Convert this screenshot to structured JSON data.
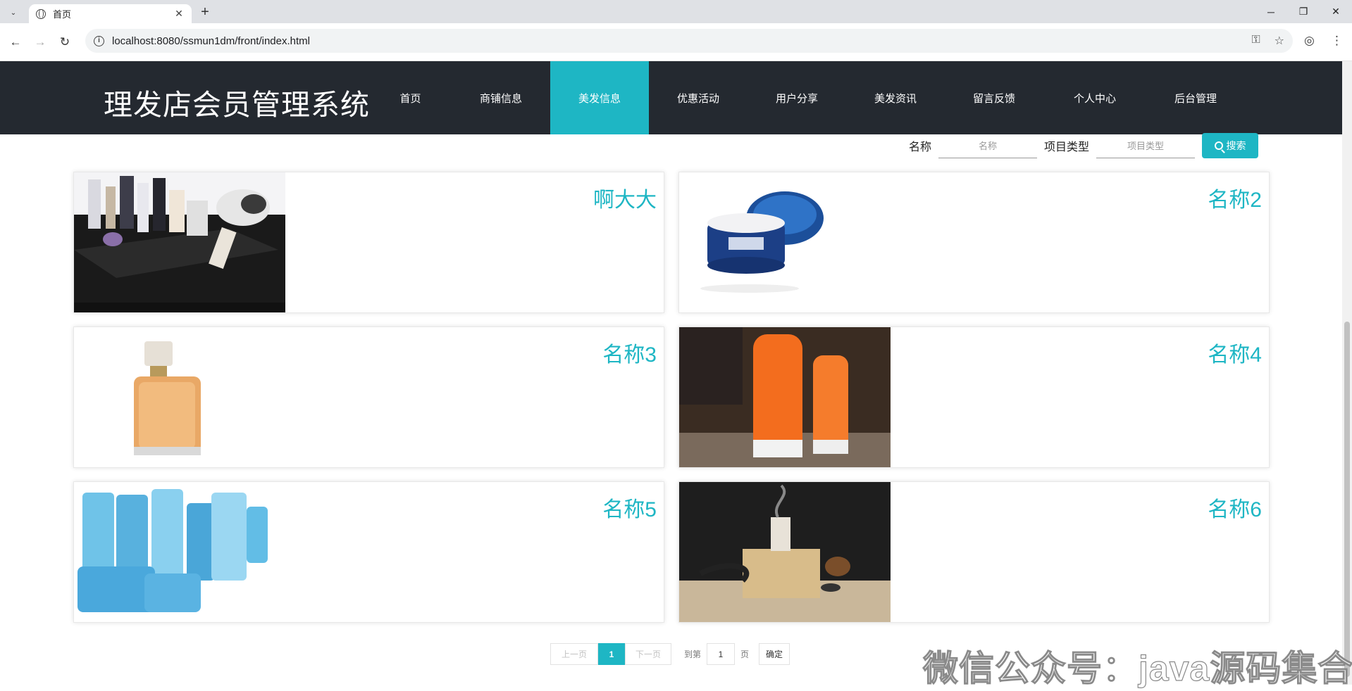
{
  "browser": {
    "tab_title": "首页",
    "url": "localhost:8080/ssmun1dm/front/index.html"
  },
  "site": {
    "title": "理发店会员管理系统",
    "nav": [
      "首页",
      "商铺信息",
      "美发信息",
      "优惠活动",
      "用户分享",
      "美发资讯",
      "留言反馈",
      "个人中心",
      "后台管理"
    ],
    "active_nav": "美发信息"
  },
  "search": {
    "name_label": "名称",
    "name_placeholder": "名称",
    "type_label": "项目类型",
    "type_placeholder": "项目类型",
    "button_label": "搜索"
  },
  "cards": [
    {
      "name": "啊大大",
      "image": "cosmetics-cart"
    },
    {
      "name": "名称2",
      "image": "cream-jar"
    },
    {
      "name": "名称3",
      "image": "perfume-bottle"
    },
    {
      "name": "名称4",
      "image": "sunscreen-tubes"
    },
    {
      "name": "名称5",
      "image": "skincare-set"
    },
    {
      "name": "名称6",
      "image": "incense-box"
    }
  ],
  "pagination": {
    "prev": "上一页",
    "current": "1",
    "next": "下一页",
    "goto_label": "到第",
    "page_value": "1",
    "page_unit": "页",
    "confirm": "确定"
  },
  "watermark": "微信公众号：java源码集合",
  "colors": {
    "accent": "#1eb6c4",
    "header_bg": "#242930"
  }
}
